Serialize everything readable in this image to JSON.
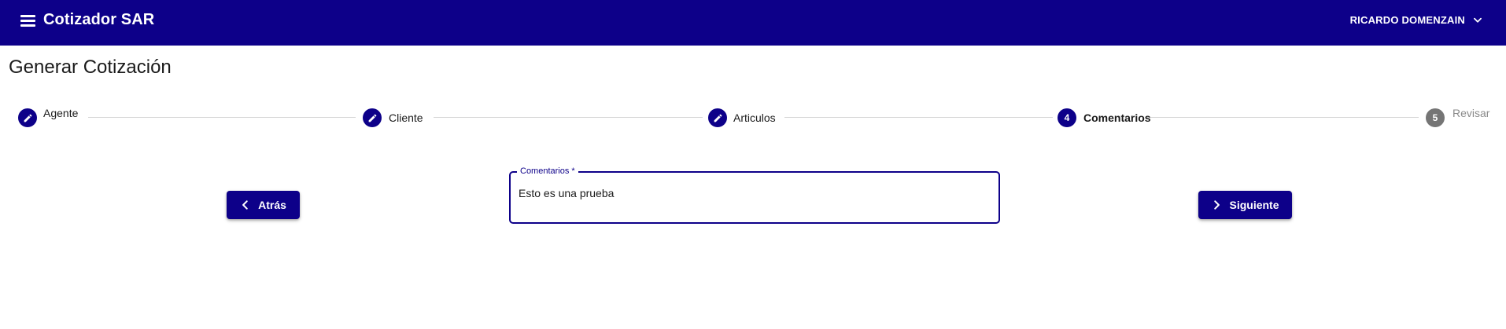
{
  "header": {
    "menu_icon": "menu-icon",
    "title": "Cotizador SAR",
    "user_name": "RICARDO DOMENZAIN",
    "user_menu_icon": "chevron-down-icon",
    "background_color": "#0d0089"
  },
  "page": {
    "title": "Generar Cotización"
  },
  "stepper": {
    "steps": [
      {
        "label": "Agente",
        "marker": "edit-icon",
        "state": "completed"
      },
      {
        "label": "Cliente",
        "marker": "edit-icon",
        "state": "completed"
      },
      {
        "label": "Articulos",
        "marker": "edit-icon",
        "state": "completed"
      },
      {
        "label": "Comentarios",
        "marker": "4",
        "state": "active"
      },
      {
        "label": "Revisar",
        "marker": "5",
        "state": "pending"
      }
    ],
    "active_color": "#0d0089",
    "pending_color": "#757575"
  },
  "form": {
    "comments_label": "Comentarios *",
    "comments_value": "Esto es una prueba"
  },
  "actions": {
    "back_label": "Atrás",
    "back_icon": "chevron-left-icon",
    "next_label": "Siguiente",
    "next_icon": "chevron-right-icon"
  }
}
